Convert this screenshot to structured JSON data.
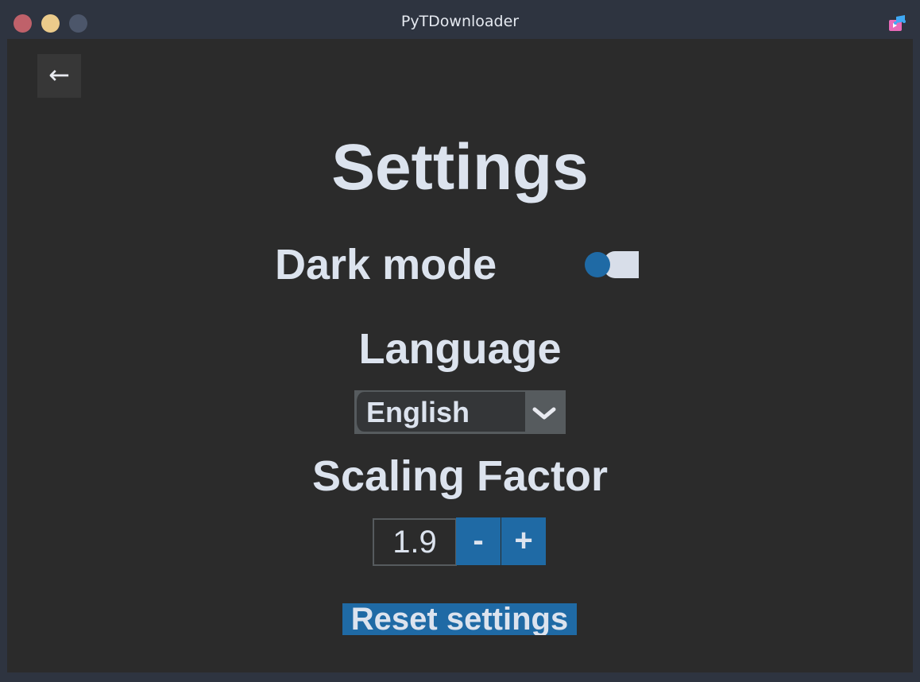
{
  "window": {
    "title": "PyTDownloader",
    "app_icon": "music-download-icon"
  },
  "colors": {
    "accent": "#1f6aa5",
    "background": "#2b2b2b",
    "titlebar": "#2e3440",
    "text": "#dce3ee"
  },
  "nav": {
    "back_label": "←"
  },
  "settings": {
    "title": "Settings",
    "dark_mode_label": "Dark mode",
    "dark_mode_on": true,
    "language_label": "Language",
    "language_value": "English",
    "scaling_label": "Scaling Factor",
    "scaling_value": "1.9",
    "decrease_label": "-",
    "increase_label": "+",
    "reset_label": "Reset settings"
  }
}
